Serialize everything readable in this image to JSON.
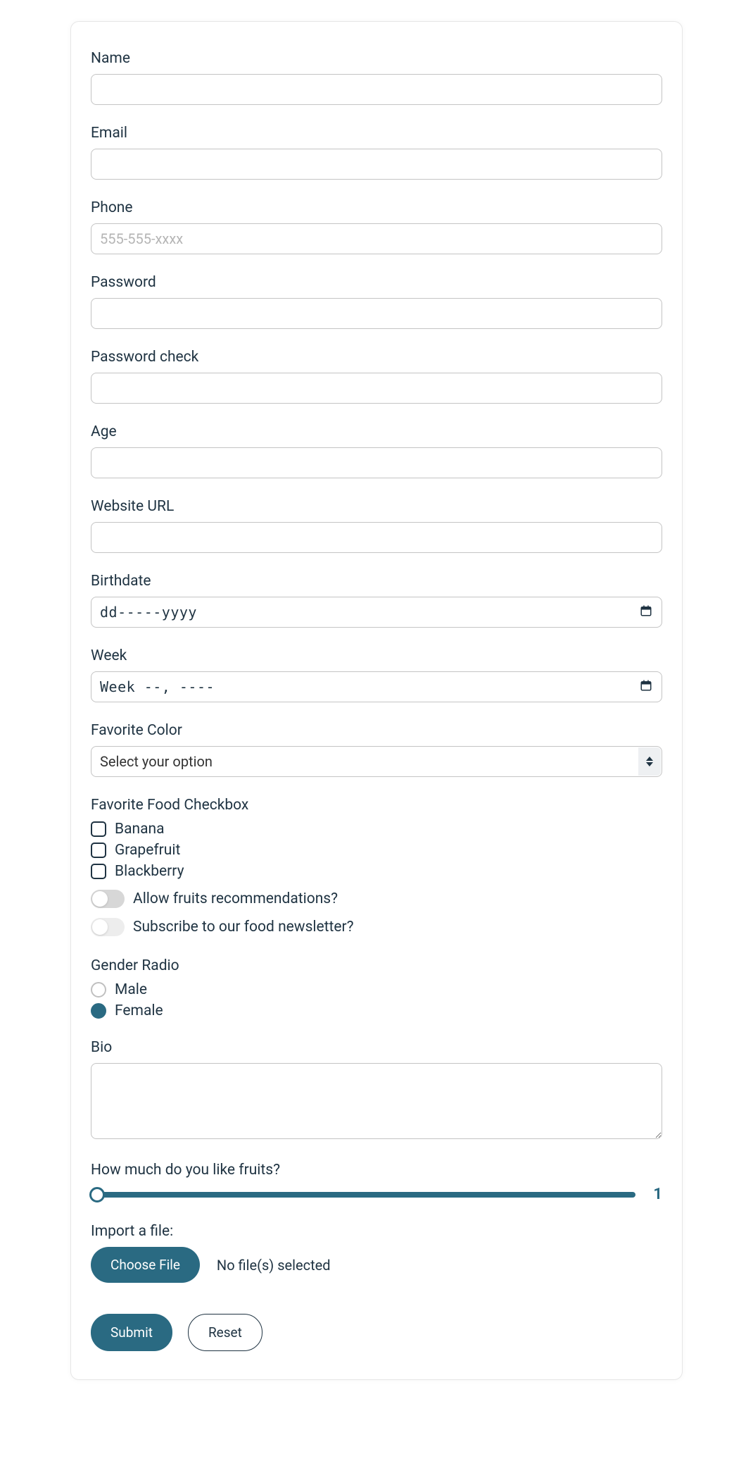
{
  "form": {
    "name": {
      "label": "Name",
      "value": ""
    },
    "email": {
      "label": "Email",
      "value": ""
    },
    "phone": {
      "label": "Phone",
      "value": "",
      "placeholder": "555-555-xxxx"
    },
    "password": {
      "label": "Password",
      "value": ""
    },
    "password_check": {
      "label": "Password check",
      "value": ""
    },
    "age": {
      "label": "Age",
      "value": ""
    },
    "website": {
      "label": "Website URL",
      "value": ""
    },
    "birthdate": {
      "label": "Birthdate",
      "value": "",
      "display": "dd-----yyyy"
    },
    "week": {
      "label": "Week",
      "value": "",
      "display": "Week --, ----"
    },
    "favorite_color": {
      "label": "Favorite Color",
      "placeholder": "Select your option",
      "selected": ""
    },
    "favorite_food": {
      "label": "Favorite Food Checkbox",
      "options": [
        {
          "label": "Banana",
          "checked": false
        },
        {
          "label": "Grapefruit",
          "checked": false
        },
        {
          "label": "Blackberry",
          "checked": false
        }
      ]
    },
    "toggles": {
      "recommendations": {
        "label": "Allow fruits recommendations?",
        "value": false
      },
      "newsletter": {
        "label": "Subscribe to our food newsletter?",
        "value": false
      }
    },
    "gender": {
      "label": "Gender Radio",
      "options": [
        {
          "label": "Male",
          "checked": false
        },
        {
          "label": "Female",
          "checked": true
        }
      ]
    },
    "bio": {
      "label": "Bio",
      "value": ""
    },
    "fruits_like": {
      "label": "How much do you like fruits?",
      "value": 1
    },
    "file": {
      "label": "Import a file:",
      "button": "Choose File",
      "status": "No file(s) selected"
    },
    "actions": {
      "submit": "Submit",
      "reset": "Reset"
    }
  }
}
